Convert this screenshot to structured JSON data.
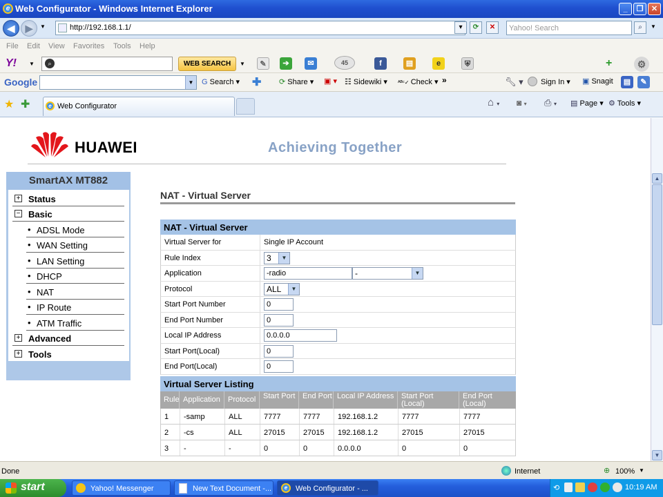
{
  "window": {
    "title": "Web Configurator - Windows Internet Explorer"
  },
  "address": {
    "url": "http://192.168.1.1/",
    "search_placeholder": "Yahoo! Search"
  },
  "menu": [
    "File",
    "Edit",
    "View",
    "Favorites",
    "Tools",
    "Help"
  ],
  "yahoo_bar": {
    "logo": "Y!",
    "web_search": "WEB SEARCH",
    "badge": "45"
  },
  "google_bar": {
    "logo": "Google",
    "search": "Search",
    "share": "Share",
    "sidewiki": "Sidewiki",
    "check": "Check",
    "sign_in": "Sign In",
    "snagit": "Snagit"
  },
  "tab": {
    "label": "Web Configurator",
    "page": "Page",
    "tools": "Tools"
  },
  "page": {
    "brand": "HUAWEI",
    "slogan": "Achieving Together",
    "heading": "NAT - Virtual Server"
  },
  "sidebar": {
    "title": "SmartAX MT882",
    "items": [
      {
        "label": "Status",
        "level": 0,
        "sign": "+"
      },
      {
        "label": "Basic",
        "level": 0,
        "sign": "−"
      },
      {
        "label": "ADSL Mode",
        "level": 1
      },
      {
        "label": "WAN Setting",
        "level": 1
      },
      {
        "label": "LAN Setting",
        "level": 1
      },
      {
        "label": "DHCP",
        "level": 1
      },
      {
        "label": "NAT",
        "level": 1
      },
      {
        "label": "IP Route",
        "level": 1
      },
      {
        "label": "ATM Traffic",
        "level": 1
      },
      {
        "label": "Advanced",
        "level": 0,
        "sign": "+"
      },
      {
        "label": "Tools",
        "level": 0,
        "sign": "+"
      }
    ]
  },
  "form": {
    "title": "NAT - Virtual Server",
    "virtual_server_for_label": "Virtual Server for",
    "virtual_server_for_value": "Single IP Account",
    "rule_index_label": "Rule Index",
    "rule_index_value": "3",
    "application_label": "Application",
    "application_value": "-radio",
    "application_select": "-",
    "protocol_label": "Protocol",
    "protocol_value": "ALL",
    "start_port_label": "Start Port Number",
    "start_port_value": "0",
    "end_port_label": "End Port Number",
    "end_port_value": "0",
    "local_ip_label": "Local IP Address",
    "local_ip_value": "0.0.0.0",
    "start_local_label": "Start Port(Local)",
    "start_local_value": "0",
    "end_local_label": "End Port(Local)",
    "end_local_value": "0"
  },
  "listing": {
    "title": "Virtual Server Listing",
    "headers": [
      "Rule",
      "Application",
      "Protocol",
      "Start Port",
      "End Port",
      "Local IP Address",
      "Start Port (Local)",
      "End Port (Local)"
    ],
    "rows": [
      [
        "1",
        "-samp",
        "ALL",
        "7777",
        "7777",
        "192.168.1.2",
        "7777",
        "7777"
      ],
      [
        "2",
        "-cs",
        "ALL",
        "27015",
        "27015",
        "192.168.1.2",
        "27015",
        "27015"
      ],
      [
        "3",
        "-",
        "-",
        "0",
        "0",
        "0.0.0.0",
        "0",
        "0"
      ]
    ]
  },
  "status": {
    "text": "Done",
    "zone": "Internet",
    "zoom": "100%"
  },
  "taskbar": {
    "start": "start",
    "tasks": [
      "Yahoo! Messenger",
      "New Text Document -...",
      "Web Configurator - ..."
    ],
    "clock": "10:19 AM"
  }
}
